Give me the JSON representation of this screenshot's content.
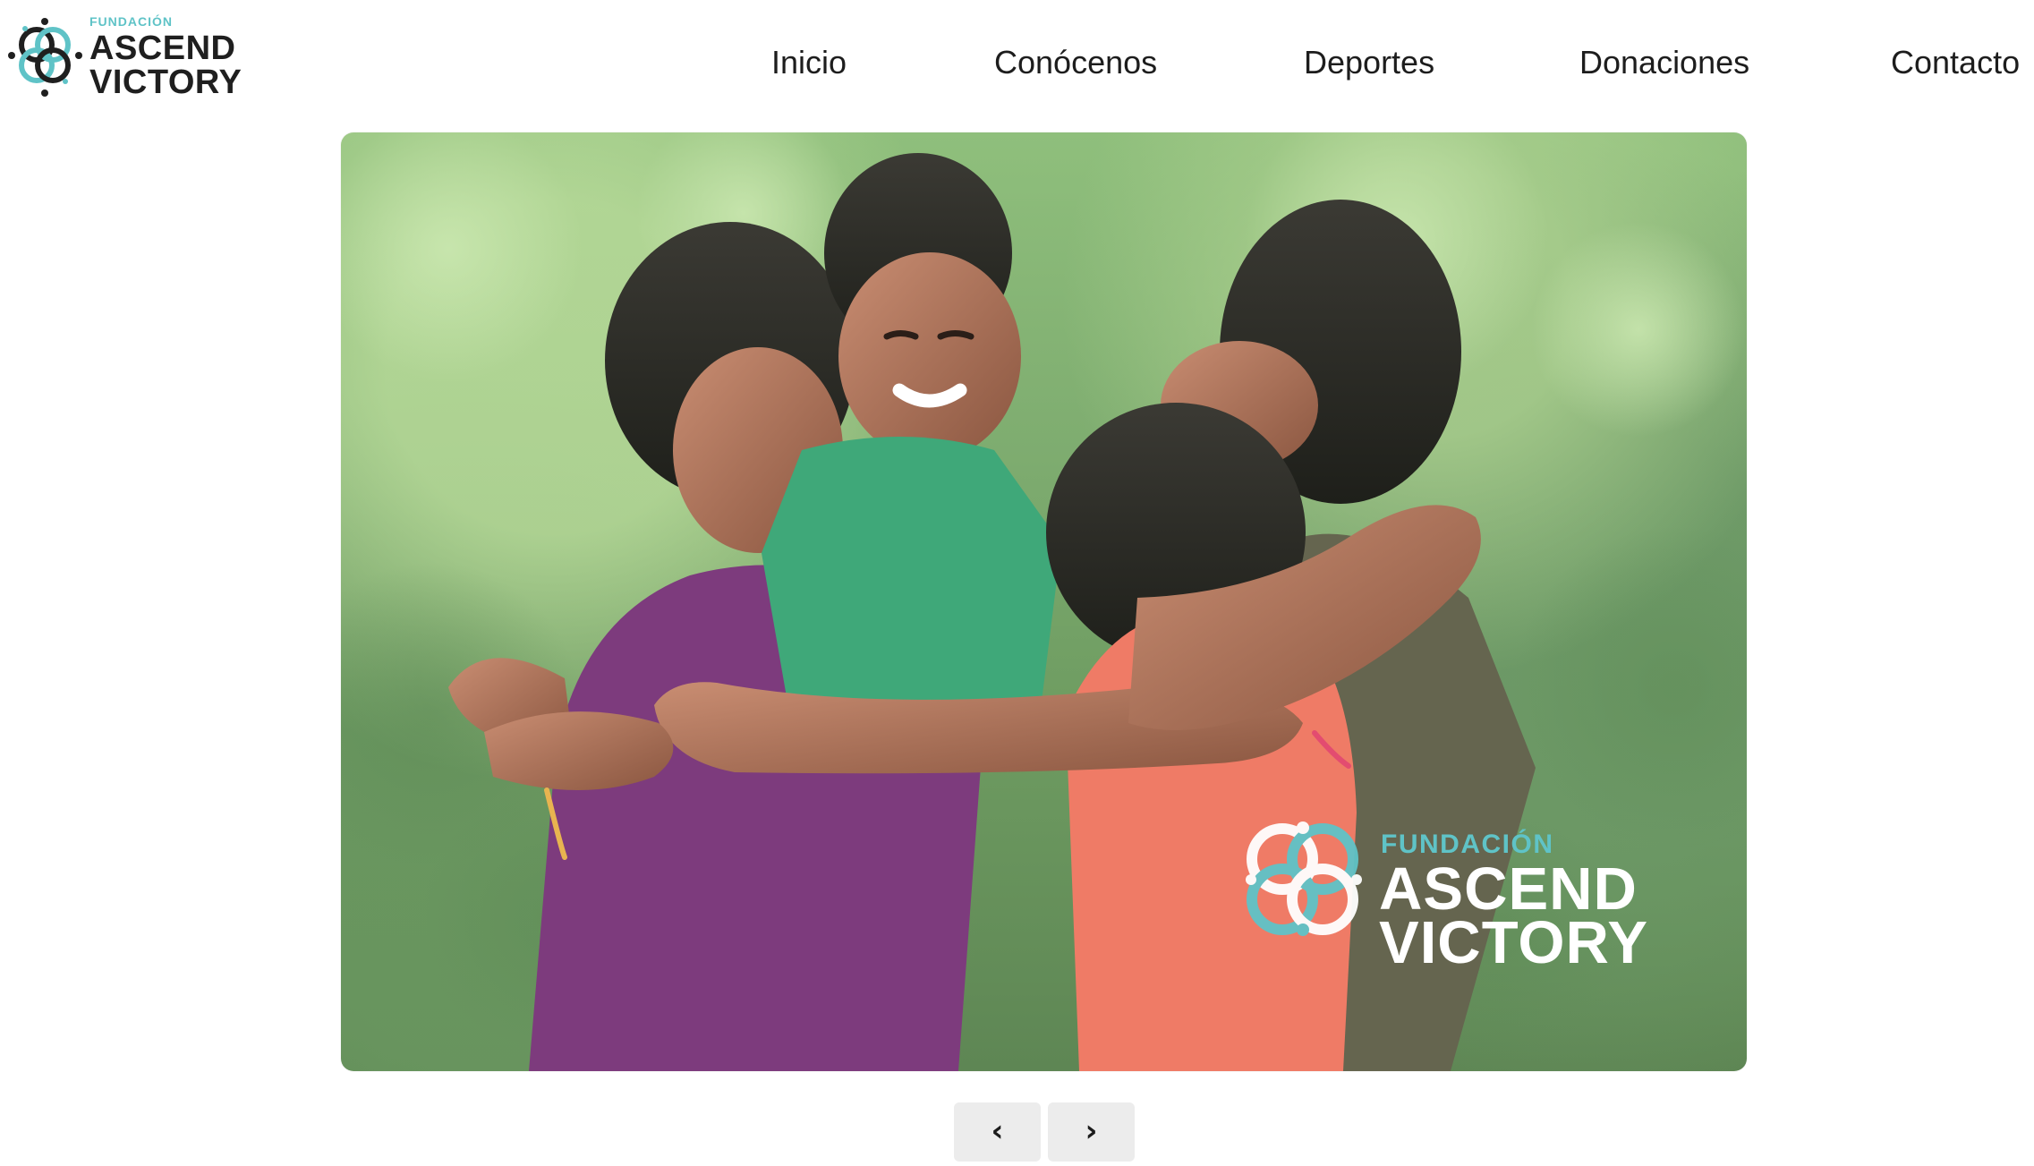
{
  "brand": {
    "small": "FUNDACIÓN",
    "line1": "ASCEND",
    "line2": "VICTORY",
    "primary_color": "#5fc3c7",
    "dark_color": "#1f1f1f"
  },
  "nav": {
    "items": [
      "Inicio",
      "Conócenos",
      "Deportes",
      "Donaciones",
      "Contacto"
    ]
  },
  "hero": {
    "watermark_small": "FUNDACIÓN",
    "watermark_line1": "ASCEND",
    "watermark_line2": "VICTORY",
    "overlay_icon": "flower-logo-icon"
  },
  "carousel": {
    "prev_icon": "chevron-left-icon",
    "next_icon": "chevron-right-icon",
    "prev_glyph": "‹",
    "next_glyph": "›"
  }
}
